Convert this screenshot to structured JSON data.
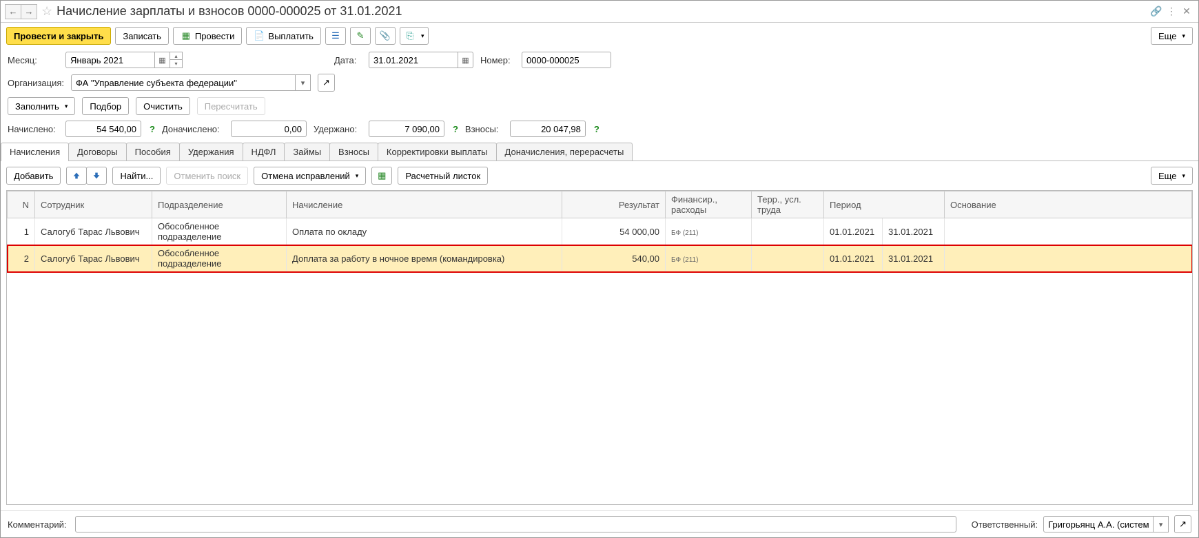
{
  "title": "Начисление зарплаты и взносов 0000-000025 от 31.01.2021",
  "toolbar": {
    "post_close": "Провести и закрыть",
    "write": "Записать",
    "post": "Провести",
    "pay": "Выплатить",
    "more": "Еще"
  },
  "form": {
    "month_label": "Месяц:",
    "month_value": "Январь 2021",
    "date_label": "Дата:",
    "date_value": "31.01.2021",
    "number_label": "Номер:",
    "number_value": "0000-000025",
    "org_label": "Организация:",
    "org_value": "ФА \"Управление субъекта федерации\""
  },
  "actions": {
    "fill": "Заполнить",
    "pick": "Подбор",
    "clear": "Очистить",
    "recalc": "Пересчитать"
  },
  "totals": {
    "accrued_label": "Начислено:",
    "accrued_value": "54 540,00",
    "extra_label": "Доначислено:",
    "extra_value": "0,00",
    "withheld_label": "Удержано:",
    "withheld_value": "7 090,00",
    "contrib_label": "Взносы:",
    "contrib_value": "20 047,98"
  },
  "tabs": [
    "Начисления",
    "Договоры",
    "Пособия",
    "Удержания",
    "НДФЛ",
    "Займы",
    "Взносы",
    "Корректировки выплаты",
    "Доначисления, перерасчеты"
  ],
  "tab_toolbar": {
    "add": "Добавить",
    "find": "Найти...",
    "cancel_search": "Отменить поиск",
    "cancel_fixes": "Отмена исправлений",
    "payslip": "Расчетный листок",
    "more": "Еще"
  },
  "columns": {
    "n": "N",
    "employee": "Сотрудник",
    "department": "Подразделение",
    "accrual": "Начисление",
    "result": "Результат",
    "finance": "Финансир., расходы",
    "terr": "Терр., усл. труда",
    "period": "Период",
    "base": "Основание"
  },
  "rows": [
    {
      "n": "1",
      "employee": "Салогуб Тарас Львович",
      "department": "Обособленное подразделение",
      "accrual": "Оплата по окладу",
      "result": "54 000,00",
      "finance": "БФ (211)",
      "terr": "",
      "period_from": "01.01.2021",
      "period_to": "31.01.2021",
      "base": "",
      "highlight": false
    },
    {
      "n": "2",
      "employee": "Салогуб Тарас Львович",
      "department": "Обособленное подразделение",
      "accrual": "Доплата за работу в ночное время (командировка)",
      "result": "540,00",
      "finance": "БФ (211)",
      "terr": "",
      "period_from": "01.01.2021",
      "period_to": "31.01.2021",
      "base": "",
      "highlight": true
    }
  ],
  "footer": {
    "comment_label": "Комментарий:",
    "comment_value": "",
    "responsible_label": "Ответственный:",
    "responsible_value": "Григорьянц А.А. (системн"
  }
}
